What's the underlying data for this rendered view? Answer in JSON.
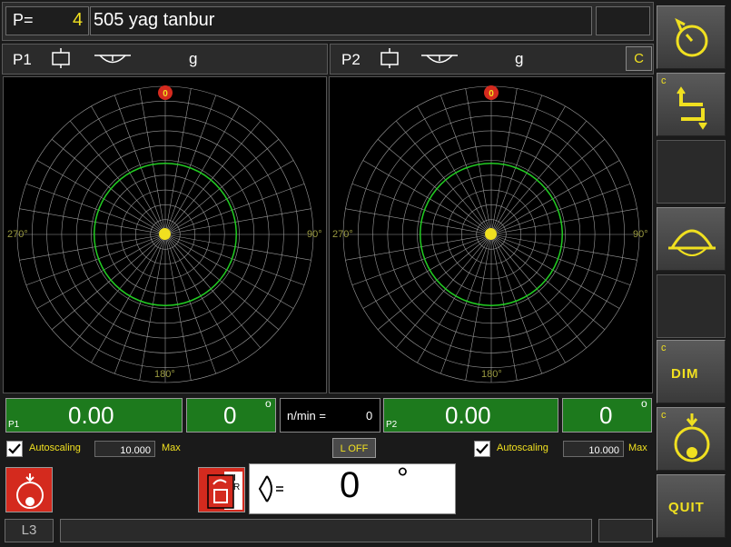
{
  "header": {
    "p_label": "P=",
    "p_value": "4",
    "title": "505 yag tanbur"
  },
  "plane1": {
    "label": "P1",
    "unit": "g"
  },
  "plane2": {
    "label": "P2",
    "unit": "g",
    "c_button": "C"
  },
  "polar": {
    "mark_top": "0",
    "angle_270": "270°",
    "angle_90": "90°",
    "angle_180": "180°"
  },
  "readout1": {
    "tag": "P1",
    "value": "0.00",
    "angle": "0",
    "deg": "o"
  },
  "readout2": {
    "tag": "P2",
    "value": "0.00",
    "angle": "0",
    "deg": "o"
  },
  "speed": {
    "label": "n/min =",
    "value": "0"
  },
  "autoscale1": {
    "label": "Autoscaling",
    "value": "10.000",
    "max": "Max"
  },
  "autoscale2": {
    "label": "Autoscaling",
    "value": "10.000",
    "max": "Max"
  },
  "loff": "L OFF",
  "angle_display": {
    "value": "0",
    "unit": "°",
    "icon_label": "I",
    "icon_r": "R"
  },
  "status": {
    "code": "L3"
  },
  "side": {
    "c1": "c",
    "c2": "c",
    "dim": "DIM",
    "c3": "c",
    "quit": "QUIT",
    "c4": "c"
  },
  "colors": {
    "accent": "#f0e020",
    "green": "#1d7a1d",
    "ring": "#22cc22",
    "red": "#d42a1e"
  }
}
